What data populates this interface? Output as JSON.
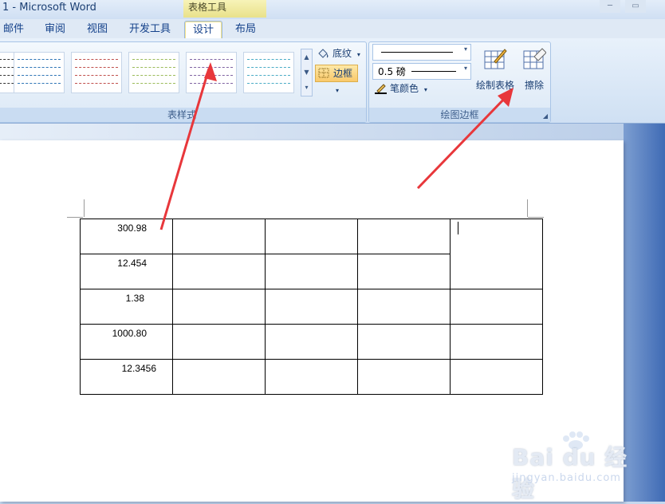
{
  "title_bar": {
    "app_title": "1 - Microsoft Word",
    "context_tab_group": "表格工具",
    "minimize": "─",
    "restore": "▭"
  },
  "tabs": [
    "邮件",
    "审阅",
    "视图",
    "开发工具",
    "设计",
    "布局"
  ],
  "active_tab": "设计",
  "ribbon": {
    "table_styles_group": "表样式",
    "shading_label": "底纹",
    "borders_label": "边框",
    "draw_borders_group": "绘图边框",
    "pen_weight": "0.5 磅",
    "pen_color_label": "笔颜色",
    "draw_table_label": "绘制表格",
    "eraser_label": "擦除",
    "thumb_colors": [
      "#4f6fa8",
      "#2e75b6",
      "#c0504d",
      "#9bbb59",
      "#8064a2",
      "#4bacc6"
    ]
  },
  "table": {
    "rows": [
      [
        "300.98",
        "",
        "",
        "",
        ""
      ],
      [
        "12.454",
        "",
        "",
        "",
        ""
      ],
      [
        "1.38",
        "",
        "",
        "",
        ""
      ],
      [
        "1000.80",
        "",
        "",
        "",
        ""
      ],
      [
        "12.3456",
        "",
        "",
        "",
        ""
      ]
    ]
  },
  "watermark": {
    "brand": "Bai du 经验",
    "site": "jingyan.baidu.com"
  },
  "colors": {
    "arrow": "#e8373b",
    "accent_tab": "#f5e38a"
  }
}
